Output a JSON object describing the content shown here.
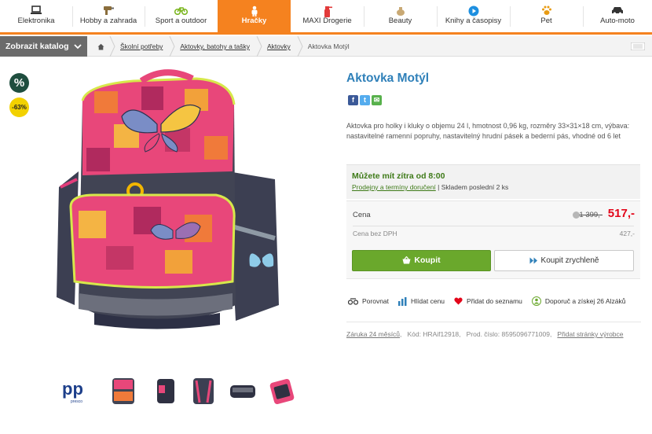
{
  "nav": {
    "categories": [
      {
        "label": "Elektronika",
        "icon": "laptop-icon"
      },
      {
        "label": "Hobby a zahrada",
        "icon": "drill-icon"
      },
      {
        "label": "Sport a outdoor",
        "icon": "bicycle-icon"
      },
      {
        "label": "Hračky",
        "icon": "toy-icon",
        "active": true
      },
      {
        "label": "MAXI Drogerie",
        "icon": "spray-bottle-icon"
      },
      {
        "label": "Beauty",
        "icon": "cosmetics-icon"
      },
      {
        "label": "Knihy a časopisy",
        "icon": "play-circle-icon"
      },
      {
        "label": "Pet",
        "icon": "paw-icon"
      },
      {
        "label": "Auto-moto",
        "icon": "car-icon"
      }
    ]
  },
  "breadcrumb": {
    "catalog_button": "Zobrazit katalog",
    "items": [
      "Školní potřeby",
      "Aktovky, batohy a tašky",
      "Aktovky"
    ],
    "current": "Aktovka Motýl"
  },
  "gallery": {
    "badge_pct": "%",
    "badge_discount": "-63%",
    "thumbnail_brand": "pp",
    "thumbnail_brand_sub": "presco"
  },
  "product": {
    "title": "Aktovka Motýl",
    "description": "Aktovka pro holky i kluky o objemu 24 l, hmotnost 0,96 kg, rozměry 33×31×18 cm, výbava: nastavitelné ramenní popruhy, nastavitelný hrudní pásek a bederní pás, vhodné od 6 let",
    "availability": {
      "headline": "Můžete mít zítra od 8:00",
      "link": "Prodejny a termíny doručení",
      "separator": " | ",
      "stock": "Skladem poslední 2 ks"
    },
    "price": {
      "label": "Cena",
      "old": "1 399,-",
      "new": "517,-",
      "vat_label": "Cena bez DPH",
      "vat_value": "427,-"
    },
    "buttons": {
      "buy": "Koupit",
      "quick_buy": "Koupit zrychleně"
    },
    "actions": {
      "compare": "Porovnat",
      "watch": "Hlídat cenu",
      "add_list": "Přidat do seznamu",
      "recommend": "Doporuč a získej 26 Alzáků"
    },
    "meta": {
      "warranty": "Záruka 24 měsíců",
      "code_label": "Kód: HRAif12918",
      "product_number": "Prod. číslo: 8595096771009",
      "add_page": "Přidat stránky výrobce"
    }
  },
  "colors": {
    "accent_orange": "#f5821f",
    "title_blue": "#2f80b9",
    "buy_green": "#6aa82c",
    "price_red": "#e3061a"
  }
}
